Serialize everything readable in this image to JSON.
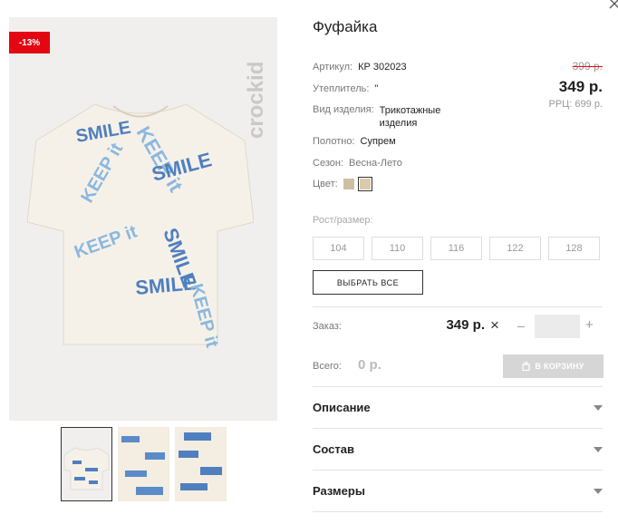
{
  "product": {
    "title": "Фуфайка",
    "discount_badge": "-13%",
    "brand_logo_text": "crockid",
    "shirt_prints": [
      "SMILE",
      "KEEP it",
      "SMILE",
      "KEEP it",
      "SMILE",
      "KEEP it",
      "SMILE",
      "KEEP it"
    ]
  },
  "details": {
    "article_label": "Артикул:",
    "article_value": "КР 302023",
    "filler_label": "Утеплитель:",
    "filler_value": "\"",
    "type_label": "Вид изделия:",
    "type_value_1": "Трикотажные",
    "type_value_2": "изделия",
    "fabric_label": "Полотно:",
    "fabric_value": "Супрем",
    "season_label": "Сезон:",
    "season_value": "Весна-Лето",
    "color_label": "Цвет:"
  },
  "pricing": {
    "old_price": "399 р.",
    "price": "349 р.",
    "rrp": "РРЦ: 699 р."
  },
  "sizes": {
    "label": "Рост/размер:",
    "options": [
      "104",
      "110",
      "116",
      "122",
      "128"
    ],
    "select_all": "ВЫБРАТЬ ВСЕ"
  },
  "order": {
    "label": "Заказ:",
    "price": "349 р.",
    "times": "×",
    "minus": "–",
    "plus": "+",
    "total_label": "Всего:",
    "total_value": "0 р.",
    "cart_button": "В КОРЗИНУ"
  },
  "accordion": {
    "items": [
      "Описание",
      "Состав",
      "Размеры"
    ]
  },
  "colors": {
    "accent": "#e30613",
    "print_blue": "#4f7fbf",
    "print_light": "#8ab8e0",
    "shirt": "#f6f1e8"
  }
}
